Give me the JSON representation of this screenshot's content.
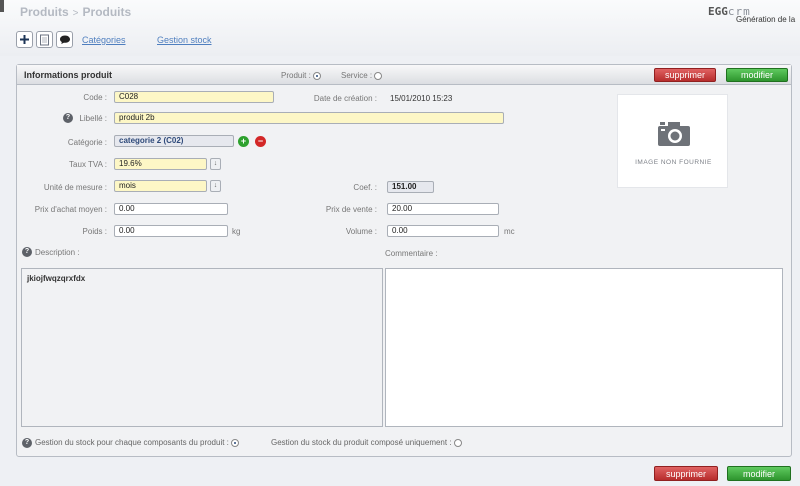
{
  "breadcrumb": {
    "root": "Produits",
    "separator": ">",
    "current": "Produits"
  },
  "brand": {
    "main": "EGG",
    "suffix": "crm",
    "subtitle": "Génération de la"
  },
  "toolbar": {
    "links": [
      {
        "label": "Catégories"
      },
      {
        "label": "Gestion stock"
      }
    ],
    "icons": [
      "add-icon",
      "document-icon",
      "comment-icon"
    ]
  },
  "panel": {
    "title": "Informations produit",
    "type_options": [
      {
        "label": "Produit :",
        "selected": true
      },
      {
        "label": "Service :",
        "selected": false
      }
    ],
    "delete_label": "supprimer",
    "modify_label": "modifier"
  },
  "form": {
    "code": {
      "label": "Code :",
      "value": "C028"
    },
    "creation": {
      "label": "Date de création :",
      "value": "15/01/2010 15:23"
    },
    "libelle": {
      "label": "Libellé :",
      "value": "produit 2b"
    },
    "categorie": {
      "label": "Catégorie :",
      "value": "categorie 2 (C02)"
    },
    "tva": {
      "label": "Taux TVA :",
      "value": "19.6%"
    },
    "unite": {
      "label": "Unité de mesure :",
      "value": "mois"
    },
    "coef": {
      "label": "Coef. :",
      "value": "151.00"
    },
    "prix_achat": {
      "label": "Prix d'achat moyen :",
      "value": "0.00"
    },
    "prix_vente": {
      "label": "Prix de vente :",
      "value": "20.00"
    },
    "poids": {
      "label": "Poids :",
      "value": "0.00",
      "unit": "kg"
    },
    "volume": {
      "label": "Volume :",
      "value": "0.00",
      "unit": "mc"
    },
    "description": {
      "label": "Description :",
      "value": "jkiojfwqzqrxfdx"
    },
    "commentaire": {
      "label": "Commentaire :",
      "value": ""
    }
  },
  "image": {
    "placeholder": "IMAGE NON FOURNIE"
  },
  "stock_options": [
    {
      "label": "Gestion du stock pour chaque composants du produit :",
      "selected": true
    },
    {
      "label": "Gestion du stock du produit composé uniquement :",
      "selected": false
    }
  ],
  "footer": {
    "delete_label": "supprimer",
    "modify_label": "modifier"
  },
  "colors": {
    "delete": "#c23a3a",
    "modify": "#3aa63a",
    "required_field": "#fdf7c6",
    "link": "#4f7fbf"
  }
}
